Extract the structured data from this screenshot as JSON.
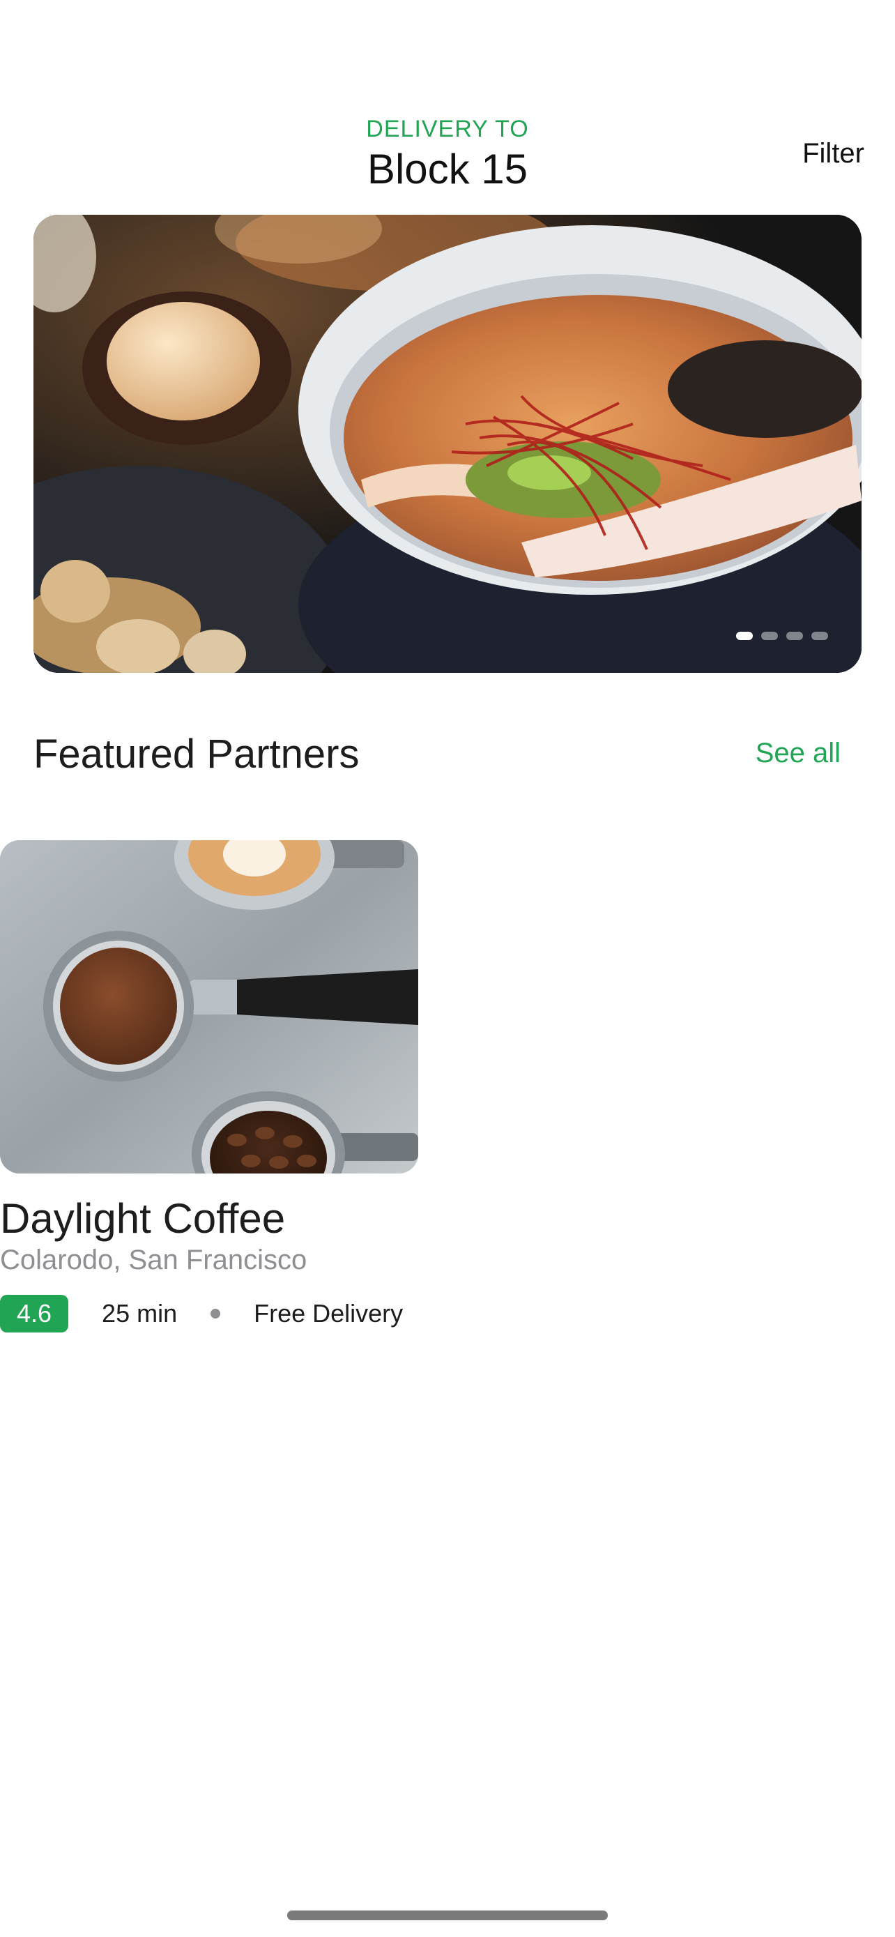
{
  "header": {
    "delivery_label": "DELIVERY TO",
    "location": "Block 15",
    "filter_label": "Filter"
  },
  "hero": {
    "image_icon": "ramen-bowl-photo",
    "slide_count": 4,
    "active_slide": 1
  },
  "featured": {
    "title": "Featured Partners",
    "see_all_label": "See all",
    "partners": [
      {
        "name": "Daylight Coffee",
        "location": "Colarodo, San Francisco",
        "rating": "4.6",
        "eta": "25 min",
        "delivery": "Free Delivery",
        "image_icon": "coffee-photo"
      }
    ]
  },
  "colors": {
    "accent": "#22a455",
    "text_primary": "#1d1d1f",
    "text_secondary": "#8e8e93"
  }
}
